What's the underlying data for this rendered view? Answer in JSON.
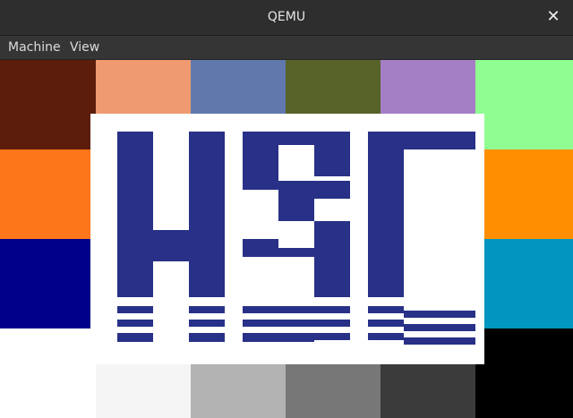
{
  "window": {
    "title": "QEMU",
    "close_glyph": "✕"
  },
  "menu": {
    "items": [
      "Machine",
      "View"
    ]
  },
  "screen": {
    "logo_text": "HSC",
    "logo_color": "#283187",
    "palette_rows": [
      [
        "#5c1d0c",
        "#ef9a70",
        "#6178ad",
        "#586329",
        "#a57fc6",
        "#8ffd91"
      ],
      [
        "#fd7619",
        "#ffffff",
        "#ffffff",
        "#ffffff",
        "#ffffff",
        "#ff8f00"
      ],
      [
        "#00008b",
        "#ffffff",
        "#ffffff",
        "#ffffff",
        "#ffffff",
        "#0096bf"
      ],
      [
        "#ffffff",
        "#f5f5f5",
        "#b3b3b3",
        "#777777",
        "#3b3b3b",
        "#000000"
      ]
    ]
  }
}
